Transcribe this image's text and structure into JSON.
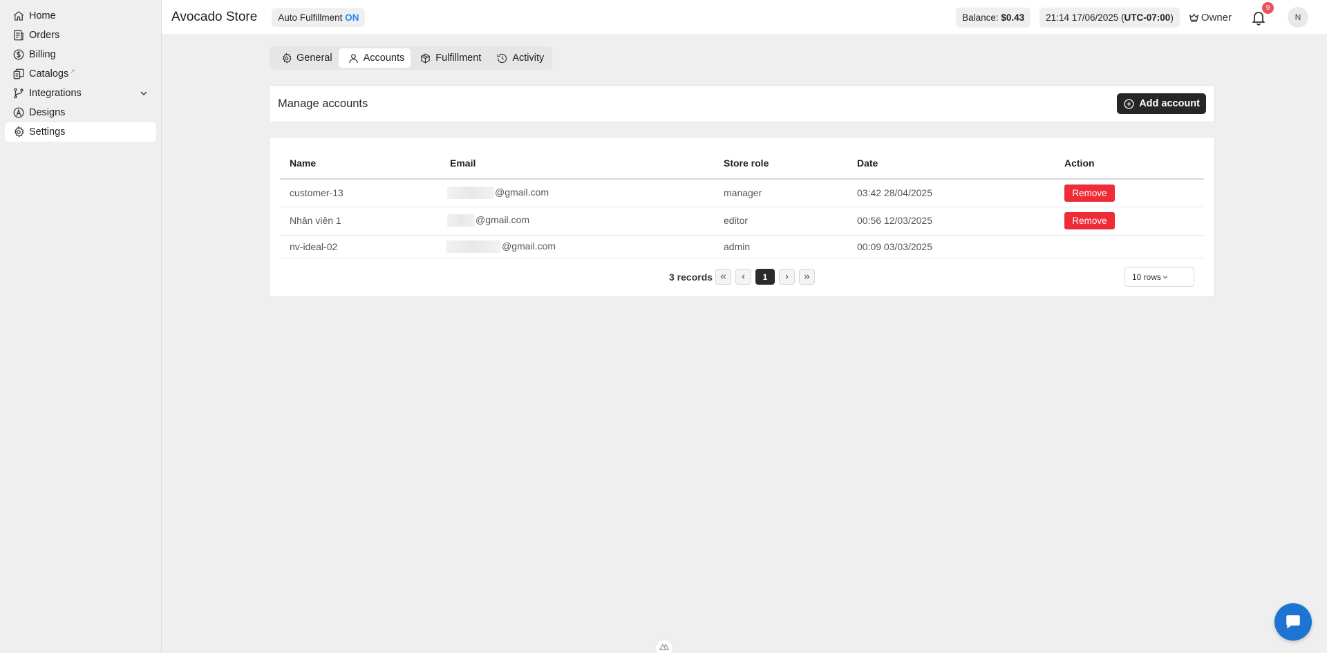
{
  "sidebar": {
    "items": [
      {
        "label": "Home",
        "icon": "home-icon"
      },
      {
        "label": "Orders",
        "icon": "orders-icon"
      },
      {
        "label": "Billing",
        "icon": "dollar-icon"
      },
      {
        "label": "Catalogs",
        "icon": "catalog-icon"
      },
      {
        "label": "Integrations",
        "icon": "branch-icon"
      },
      {
        "label": "Designs",
        "icon": "designs-icon"
      },
      {
        "label": "Settings",
        "icon": "gear-icon"
      }
    ]
  },
  "header": {
    "store_name": "Avocado Store",
    "auto_fulfillment_label": "Auto Fulfillment",
    "auto_fulfillment_state": "ON",
    "balance_label": "Balance:",
    "balance_value": "$0.43",
    "datetime": "21:14 17/06/2025",
    "timezone": "UTC-07:00",
    "role": "Owner",
    "notification_count": "9",
    "avatar_initial": "N"
  },
  "tabs": [
    {
      "label": "General",
      "icon": "gear-icon"
    },
    {
      "label": "Accounts",
      "icon": "user-icon"
    },
    {
      "label": "Fulfillment",
      "icon": "box-icon"
    },
    {
      "label": "Activity",
      "icon": "history-icon"
    }
  ],
  "manage": {
    "title": "Manage accounts",
    "add_button": "Add account"
  },
  "table": {
    "columns": [
      "Name",
      "Email",
      "Store role",
      "Date",
      "Action"
    ],
    "rows": [
      {
        "name": "customer-13",
        "email": "@gmail.com",
        "role": "manager",
        "date": "03:42 28/04/2025",
        "action": "Remove"
      },
      {
        "name": "Nhân viên 1",
        "email": "@gmail.com",
        "role": "editor",
        "date": "00:56 12/03/2025",
        "action": "Remove"
      },
      {
        "name": "nv-ideal-02",
        "email": "@gmail.com",
        "role": "admin",
        "date": "00:09 03/03/2025",
        "action": ""
      }
    ]
  },
  "pagination": {
    "records": "3 records",
    "current_page": "1",
    "rows_per_page": "10 rows"
  },
  "colors": {
    "accent_on": "#2d7ff9",
    "remove": "#ef2b37",
    "chat": "#1e74d2",
    "badge": "#e8525a"
  }
}
